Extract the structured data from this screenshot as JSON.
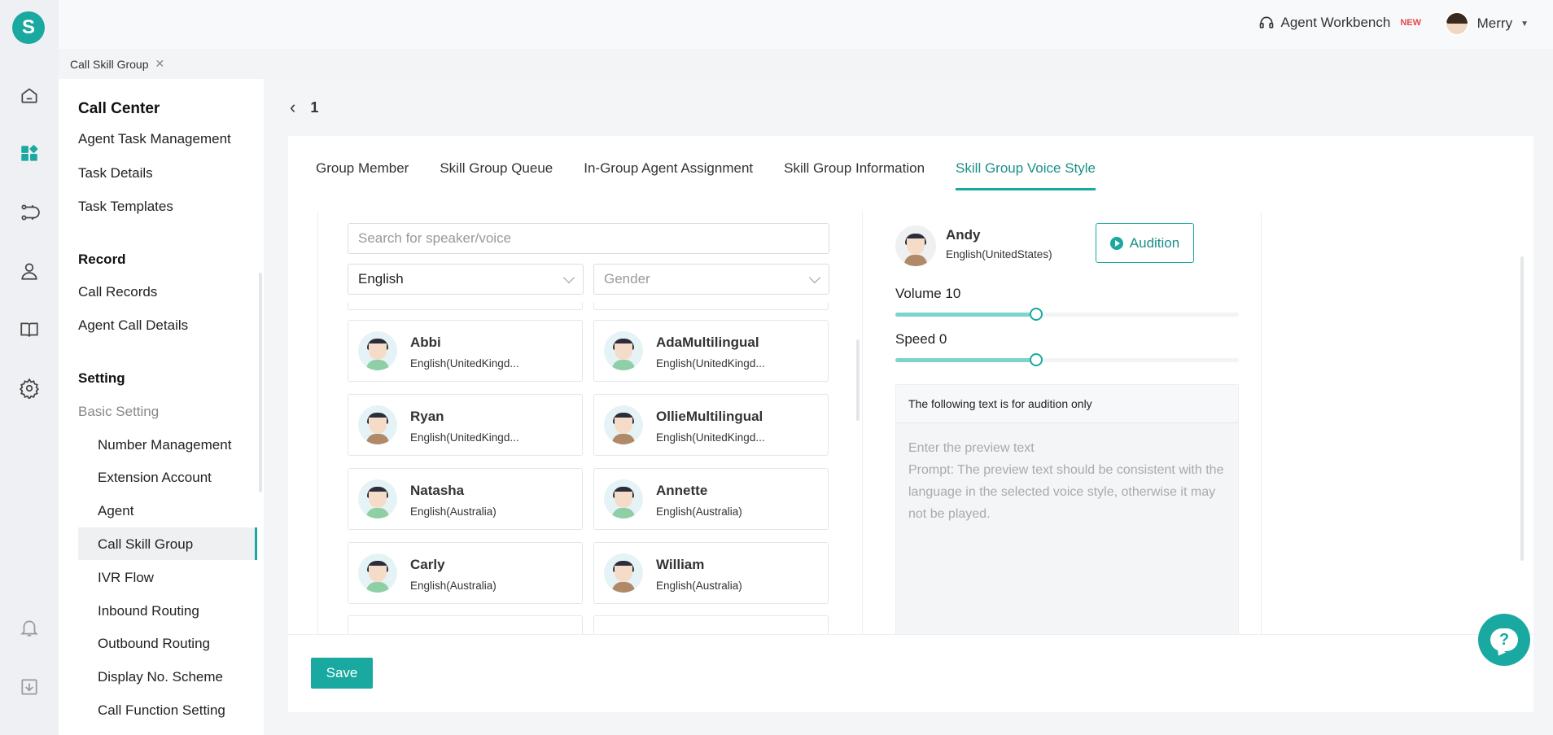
{
  "app": {
    "logo_letter": "S",
    "brand_color": "#1aa9a0"
  },
  "header": {
    "workbench_label": "Agent Workbench",
    "workbench_badge": "NEW",
    "user_name": "Merry"
  },
  "tabstrip": {
    "active_tab": "Call Skill Group"
  },
  "rail": {
    "icons": [
      "home-icon",
      "apps-icon",
      "flow-icon",
      "agent-icon",
      "book-icon",
      "settings-icon",
      "bell-icon",
      "download-icon"
    ]
  },
  "sidemenu": {
    "title": "Call Center",
    "items_top": [
      "Agent Task Management",
      "Task Details",
      "Task Templates"
    ],
    "record_section": "Record",
    "record_items": [
      "Call Records",
      "Agent Call Details"
    ],
    "setting_section": "Setting",
    "basic_setting": "Basic Setting",
    "sub_items": [
      "Number Management",
      "Extension Account",
      "Agent",
      "Call Skill Group",
      "IVR Flow",
      "Inbound Routing",
      "Outbound Routing",
      "Display No. Scheme",
      "Call Function Setting"
    ]
  },
  "page": {
    "back_title": "1",
    "tabs": [
      "Group Member",
      "Skill Group Queue",
      "In-Group Agent Assignment",
      "Skill Group Information",
      "Skill Group Voice Style"
    ],
    "active_tab_index": 4
  },
  "voice_list": {
    "search_placeholder": "Search for speaker/voice",
    "language_select": "English",
    "gender_placeholder": "Gender",
    "voices": [
      {
        "name": "Abbi",
        "lang": "English(UnitedKingd..."
      },
      {
        "name": "AdaMultilingual",
        "lang": "English(UnitedKingd..."
      },
      {
        "name": "Ryan",
        "lang": "English(UnitedKingd..."
      },
      {
        "name": "OllieMultilingual",
        "lang": "English(UnitedKingd..."
      },
      {
        "name": "Natasha",
        "lang": "English(Australia)"
      },
      {
        "name": "Annette",
        "lang": "English(Australia)"
      },
      {
        "name": "Carly",
        "lang": "English(Australia)"
      },
      {
        "name": "William",
        "lang": "English(Australia)"
      }
    ]
  },
  "detail": {
    "speaker_name": "Andy",
    "speaker_lang": "English(UnitedStates)",
    "audition_label": "Audition",
    "volume_label": "Volume 10",
    "volume_fraction": 0.41,
    "speed_label": "Speed 0",
    "speed_fraction": 0.41,
    "preview_header": "The following text is for audition only",
    "preview_placeholder": "Enter the preview text",
    "preview_prompt": "Prompt: The preview text should be consistent with the language in the selected voice style, otherwise it may not be played."
  },
  "footer": {
    "save_label": "Save"
  }
}
